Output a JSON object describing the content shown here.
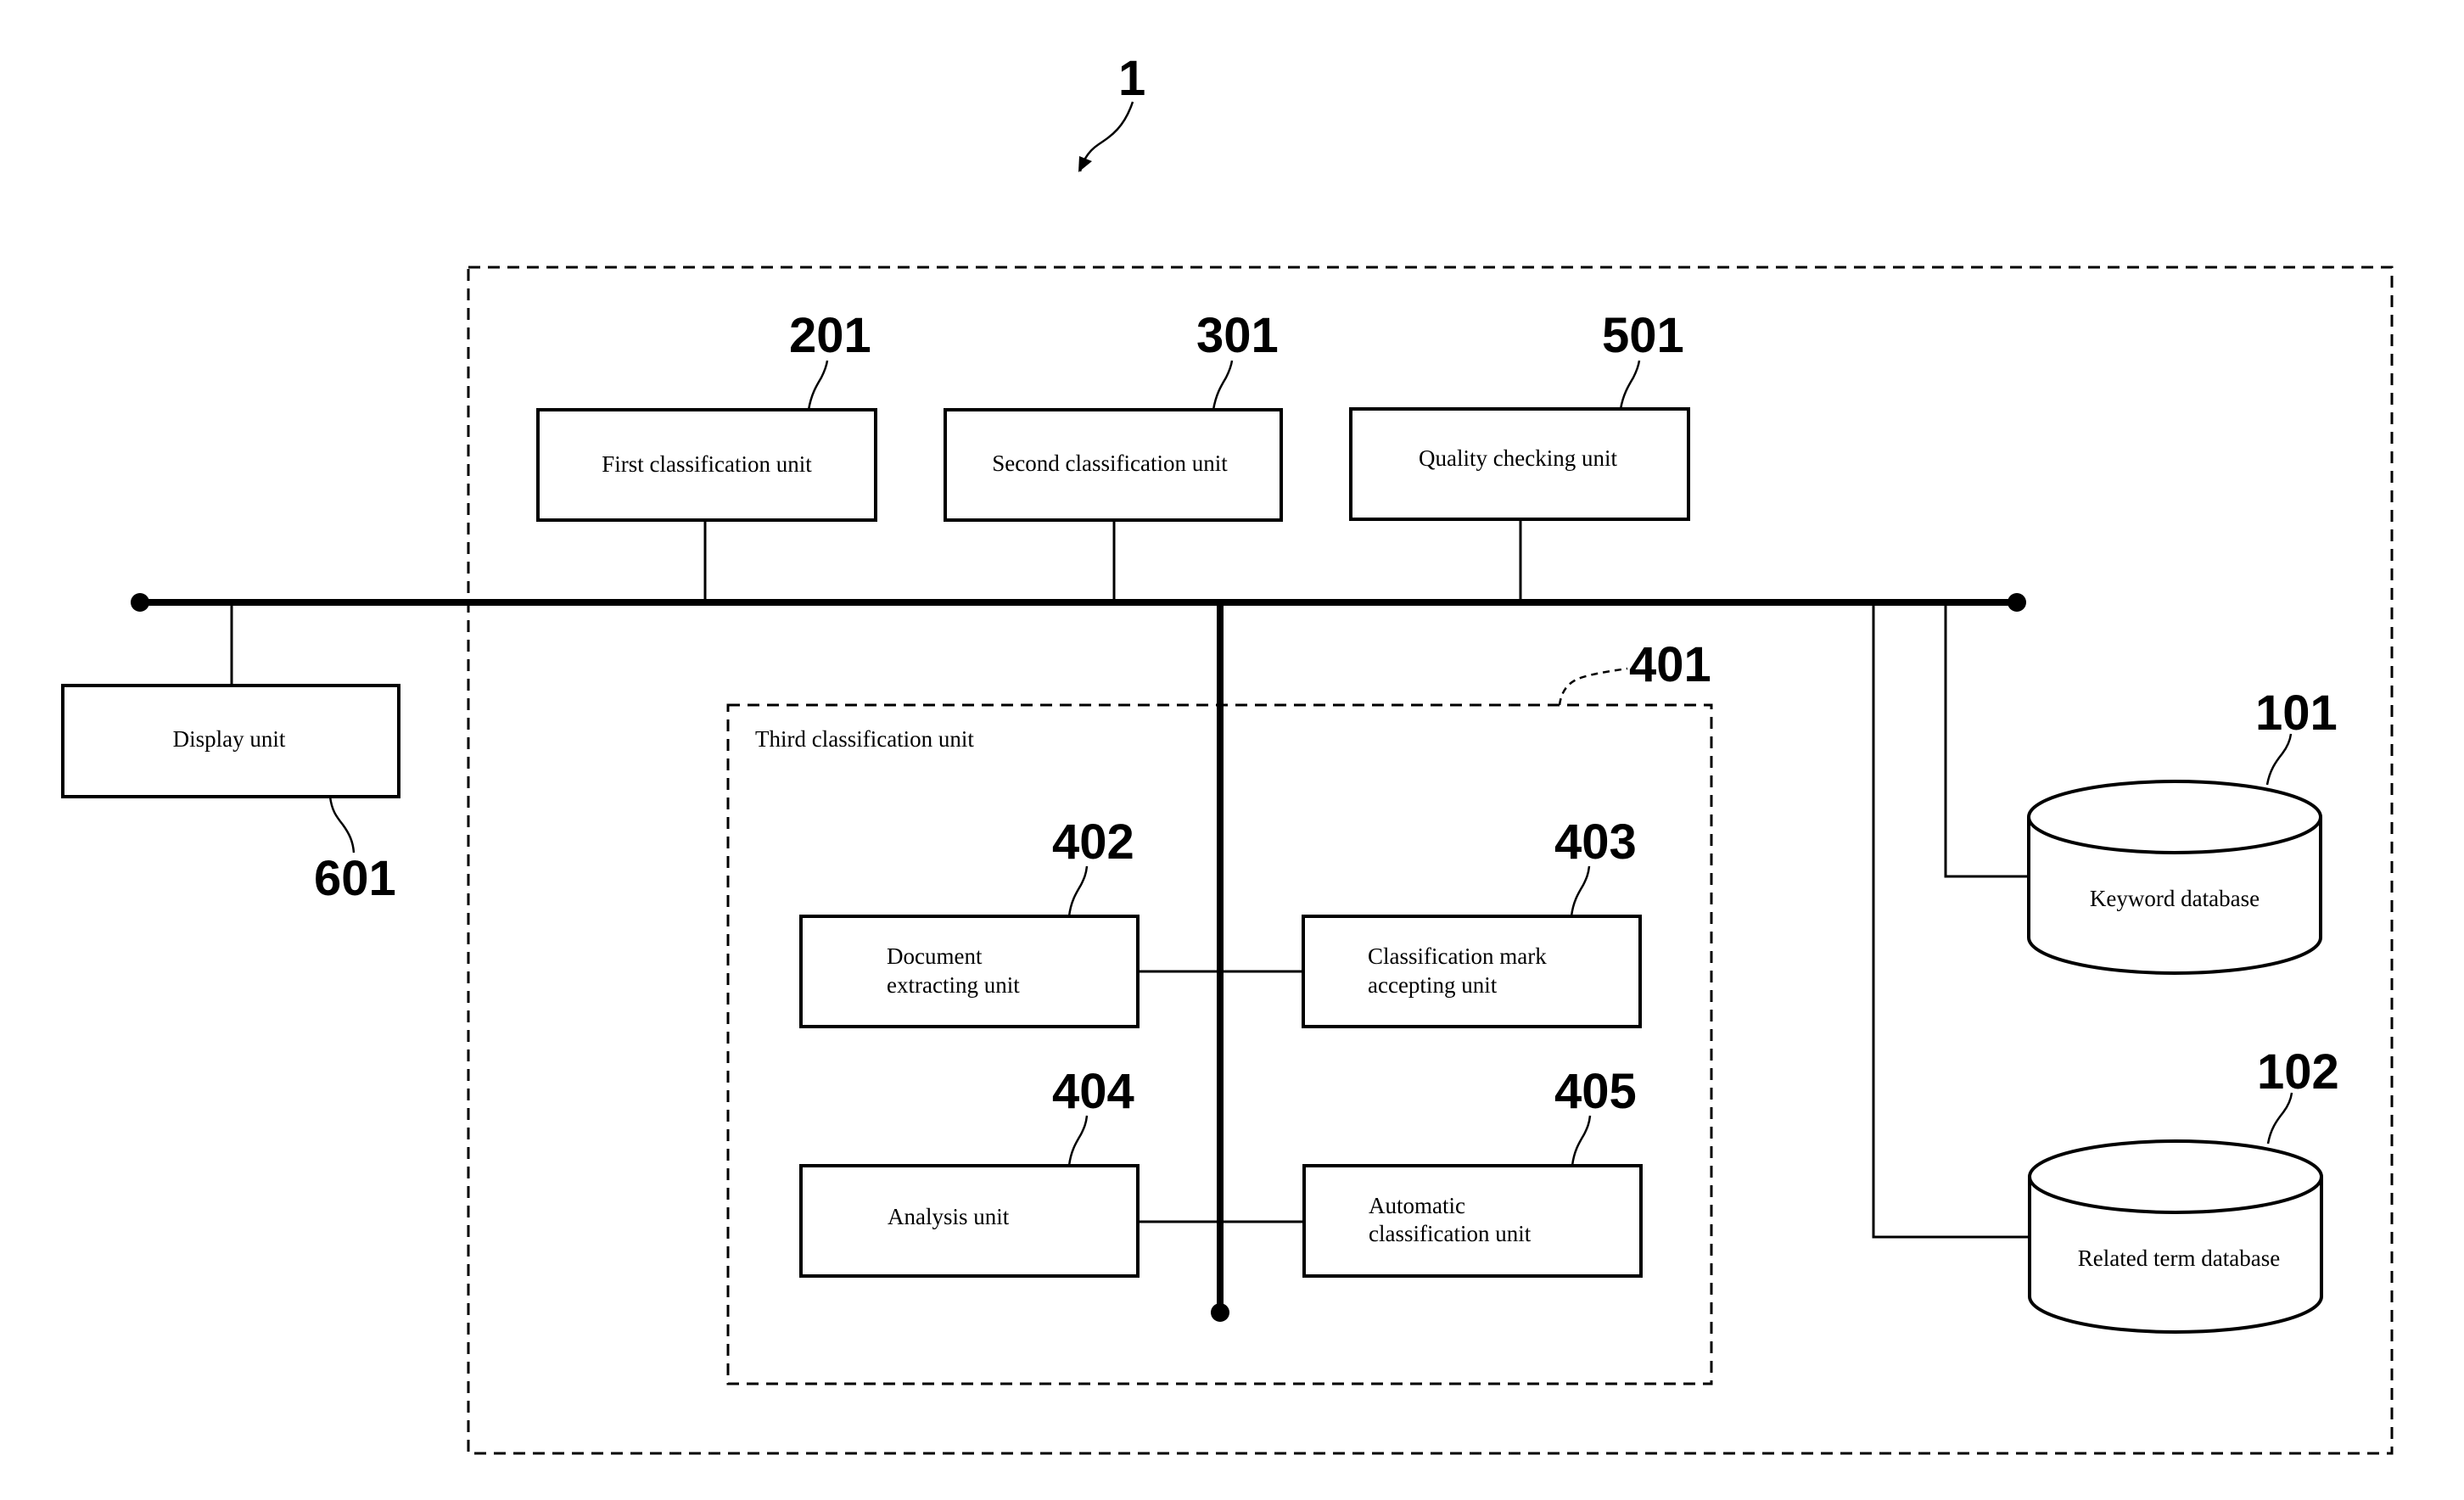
{
  "figure": {
    "system_ref": "1",
    "units": {
      "first_classification": {
        "ref": "201",
        "label": "First classification unit"
      },
      "second_classification": {
        "ref": "301",
        "label": "Second classification unit"
      },
      "quality_checking": {
        "ref": "501",
        "label": "Quality checking unit"
      },
      "display": {
        "ref": "601",
        "label": "Display unit"
      },
      "third_classification": {
        "ref": "401",
        "label": "Third classification unit",
        "document_extracting": {
          "ref": "402",
          "lines": [
            "Document",
            "extracting unit"
          ]
        },
        "classification_mark_accepting": {
          "ref": "403",
          "lines": [
            "Classification mark",
            "accepting unit"
          ]
        },
        "analysis": {
          "ref": "404",
          "label": "Analysis unit"
        },
        "automatic_classification": {
          "ref": "405",
          "lines": [
            "Automatic",
            "classification unit"
          ]
        }
      }
    },
    "databases": {
      "keyword": {
        "ref": "101",
        "label": "Keyword database"
      },
      "related_term": {
        "ref": "102",
        "label": "Related term database"
      }
    }
  }
}
